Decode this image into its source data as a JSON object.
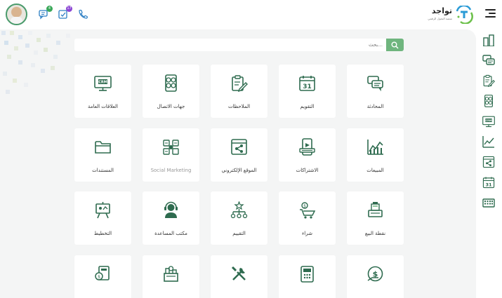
{
  "colors": {
    "accent": "#2e6b4f",
    "button": "#6fb57e",
    "badge_green": "#3aa859",
    "badge_purple": "#8b46d3",
    "bg": "#f4f5f5"
  },
  "header": {
    "logo_title": "تواجد",
    "logo_subtitle": "منصة التحول الرقمي",
    "messages_badge": "4",
    "notifications_badge": "17",
    "icons": [
      "avatar",
      "chat-icon",
      "notification-icon",
      "phone-icon",
      "menu-icon"
    ]
  },
  "search": {
    "placeholder": "بحث...",
    "value": ""
  },
  "apps": [
    {
      "label": "المحادثة",
      "icon": "chat-bubbles-icon"
    },
    {
      "label": "التقويم",
      "icon": "calendar-icon"
    },
    {
      "label": "الملاحظات",
      "icon": "notes-icon"
    },
    {
      "label": "جهات الاتصال",
      "icon": "contacts-icon"
    },
    {
      "label": "العلاقات العامة",
      "icon": "crm-icon"
    },
    {
      "label": "المبيعات",
      "icon": "sales-chart-icon"
    },
    {
      "label": "الاشتراكات",
      "icon": "subscriptions-icon"
    },
    {
      "label": "الموقع الإلكتروني",
      "icon": "website-icon"
    },
    {
      "label": "Social Marketing",
      "icon": "social-marketing-icon"
    },
    {
      "label": "المستندات",
      "icon": "folder-icon"
    },
    {
      "label": "نقطة البيع",
      "icon": "point-of-sale-icon"
    },
    {
      "label": "شراء",
      "icon": "purchase-icon"
    },
    {
      "label": "التقييم",
      "icon": "evaluation-icon"
    },
    {
      "label": "مكتب المساعدة",
      "icon": "helpdesk-icon"
    },
    {
      "label": "التخطيط",
      "icon": "planning-icon"
    },
    {
      "label": "",
      "icon": "inventory-icon"
    },
    {
      "label": "",
      "icon": "manufacturing-icon"
    },
    {
      "label": "",
      "icon": "repairs-icon"
    },
    {
      "label": "",
      "icon": "accounting-icon"
    },
    {
      "label": "",
      "icon": "expenses-icon"
    }
  ],
  "sidebar": [
    "sales-icon",
    "chat-icon",
    "notes-icon",
    "contacts-icon",
    "crm-icon",
    "chart-icon",
    "website-icon",
    "calendar-icon",
    "keyboard-icon"
  ]
}
